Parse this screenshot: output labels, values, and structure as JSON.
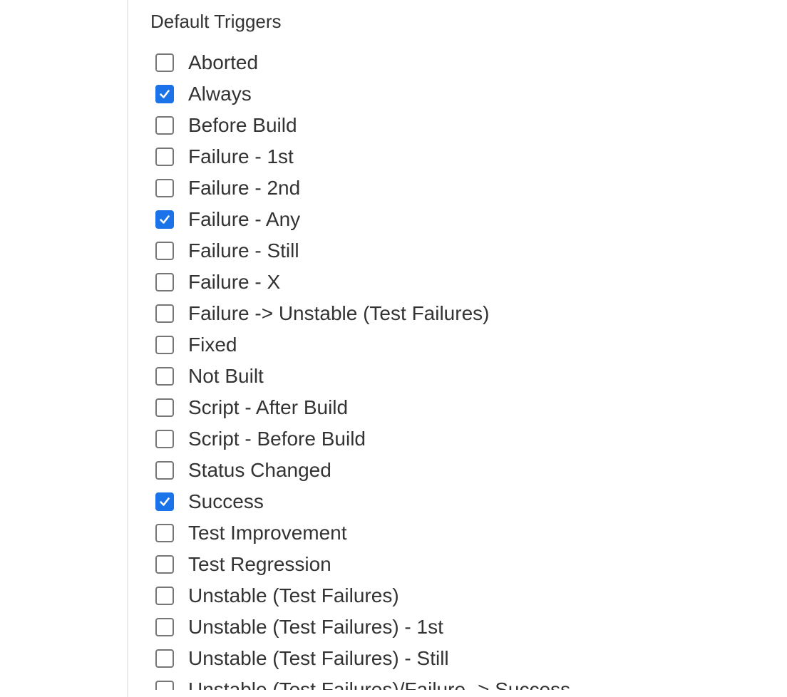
{
  "section": {
    "title": "Default Triggers"
  },
  "colors": {
    "checkbox_checked": "#1a73e8",
    "checkbox_border": "#767676",
    "text": "#333333"
  },
  "triggers": [
    {
      "label": "Aborted",
      "checked": false
    },
    {
      "label": "Always",
      "checked": true
    },
    {
      "label": "Before Build",
      "checked": false
    },
    {
      "label": "Failure - 1st",
      "checked": false
    },
    {
      "label": "Failure - 2nd",
      "checked": false
    },
    {
      "label": "Failure - Any",
      "checked": true
    },
    {
      "label": "Failure - Still",
      "checked": false
    },
    {
      "label": "Failure - X",
      "checked": false
    },
    {
      "label": "Failure -> Unstable (Test Failures)",
      "checked": false
    },
    {
      "label": "Fixed",
      "checked": false
    },
    {
      "label": "Not Built",
      "checked": false
    },
    {
      "label": "Script - After Build",
      "checked": false
    },
    {
      "label": "Script - Before Build",
      "checked": false
    },
    {
      "label": "Status Changed",
      "checked": false
    },
    {
      "label": "Success",
      "checked": true
    },
    {
      "label": "Test Improvement",
      "checked": false
    },
    {
      "label": "Test Regression",
      "checked": false
    },
    {
      "label": "Unstable (Test Failures)",
      "checked": false
    },
    {
      "label": "Unstable (Test Failures) - 1st",
      "checked": false
    },
    {
      "label": "Unstable (Test Failures) - Still",
      "checked": false
    },
    {
      "label": "Unstable (Test Failures)/Failure -> Success",
      "checked": false
    }
  ]
}
